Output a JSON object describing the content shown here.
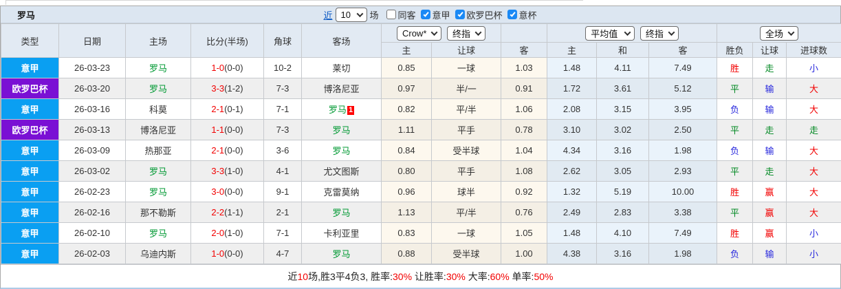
{
  "header": {
    "team_title": "罗马",
    "recent_prefix": "近",
    "recent_select_value": "10",
    "recent_suffix": "场",
    "filters": [
      {
        "label": "同客",
        "checked": false
      },
      {
        "label": "意甲",
        "checked": true
      },
      {
        "label": "欧罗巴杯",
        "checked": true
      },
      {
        "label": "意杯",
        "checked": true
      }
    ]
  },
  "table": {
    "top_headers": [
      "类型",
      "日期",
      "主场",
      "比分(半场)",
      "角球",
      "客场"
    ],
    "selects": {
      "bookmaker": "Crow*",
      "bookmaker_final": "终指",
      "average": "平均值",
      "average_final": "终指",
      "full_match": "全场"
    },
    "sub_headers": [
      "主",
      "让球",
      "客",
      "主",
      "和",
      "客",
      "胜负",
      "让球",
      "进球数"
    ],
    "rows": [
      {
        "type": "意甲",
        "type_style": "blue",
        "date": "26-03-23",
        "home": "罗马",
        "home_focus": true,
        "score_ft": "1-0",
        "score_ht": "(0-0)",
        "corners": "10-2",
        "away": "莱切",
        "away_focus": false,
        "away_badge": "",
        "crow_home": "0.85",
        "handicap": "一球",
        "crow_away": "1.03",
        "avg_home": "1.48",
        "avg_draw": "4.11",
        "avg_away": "7.49",
        "res_wdl": {
          "t": "胜",
          "c": "red"
        },
        "res_handicap": {
          "t": "走",
          "c": "green"
        },
        "res_goals": {
          "t": "小",
          "c": "blue"
        }
      },
      {
        "type": "欧罗巴杯",
        "type_style": "purple",
        "date": "26-03-20",
        "home": "罗马",
        "home_focus": true,
        "score_ft": "3-3",
        "score_ht": "(1-2)",
        "corners": "7-3",
        "away": "博洛尼亚",
        "away_focus": false,
        "away_badge": "",
        "crow_home": "0.97",
        "handicap": "半/一",
        "crow_away": "0.91",
        "avg_home": "1.72",
        "avg_draw": "3.61",
        "avg_away": "5.12",
        "res_wdl": {
          "t": "平",
          "c": "green"
        },
        "res_handicap": {
          "t": "输",
          "c": "blue"
        },
        "res_goals": {
          "t": "大",
          "c": "red"
        }
      },
      {
        "type": "意甲",
        "type_style": "blue",
        "date": "26-03-16",
        "home": "科莫",
        "home_focus": false,
        "score_ft": "2-1",
        "score_ht": "(0-1)",
        "corners": "7-1",
        "away": "罗马",
        "away_focus": true,
        "away_badge": "1",
        "crow_home": "0.82",
        "handicap": "平/半",
        "crow_away": "1.06",
        "avg_home": "2.08",
        "avg_draw": "3.15",
        "avg_away": "3.95",
        "res_wdl": {
          "t": "负",
          "c": "blue"
        },
        "res_handicap": {
          "t": "输",
          "c": "blue"
        },
        "res_goals": {
          "t": "大",
          "c": "red"
        }
      },
      {
        "type": "欧罗巴杯",
        "type_style": "purple",
        "date": "26-03-13",
        "home": "博洛尼亚",
        "home_focus": false,
        "score_ft": "1-1",
        "score_ht": "(0-0)",
        "corners": "7-3",
        "away": "罗马",
        "away_focus": true,
        "away_badge": "",
        "crow_home": "1.11",
        "handicap": "平手",
        "crow_away": "0.78",
        "avg_home": "3.10",
        "avg_draw": "3.02",
        "avg_away": "2.50",
        "res_wdl": {
          "t": "平",
          "c": "green"
        },
        "res_handicap": {
          "t": "走",
          "c": "green"
        },
        "res_goals": {
          "t": "走",
          "c": "green"
        }
      },
      {
        "type": "意甲",
        "type_style": "blue",
        "date": "26-03-09",
        "home": "热那亚",
        "home_focus": false,
        "score_ft": "2-1",
        "score_ht": "(0-0)",
        "corners": "3-6",
        "away": "罗马",
        "away_focus": true,
        "away_badge": "",
        "crow_home": "0.84",
        "handicap": "受半球",
        "crow_away": "1.04",
        "avg_home": "4.34",
        "avg_draw": "3.16",
        "avg_away": "1.98",
        "res_wdl": {
          "t": "负",
          "c": "blue"
        },
        "res_handicap": {
          "t": "输",
          "c": "blue"
        },
        "res_goals": {
          "t": "大",
          "c": "red"
        }
      },
      {
        "type": "意甲",
        "type_style": "blue",
        "date": "26-03-02",
        "home": "罗马",
        "home_focus": true,
        "score_ft": "3-3",
        "score_ht": "(1-0)",
        "corners": "4-1",
        "away": "尤文图斯",
        "away_focus": false,
        "away_badge": "",
        "crow_home": "0.80",
        "handicap": "平手",
        "crow_away": "1.08",
        "avg_home": "2.62",
        "avg_draw": "3.05",
        "avg_away": "2.93",
        "res_wdl": {
          "t": "平",
          "c": "green"
        },
        "res_handicap": {
          "t": "走",
          "c": "green"
        },
        "res_goals": {
          "t": "大",
          "c": "red"
        }
      },
      {
        "type": "意甲",
        "type_style": "blue",
        "date": "26-02-23",
        "home": "罗马",
        "home_focus": true,
        "score_ft": "3-0",
        "score_ht": "(0-0)",
        "corners": "9-1",
        "away": "克雷莫纳",
        "away_focus": false,
        "away_badge": "",
        "crow_home": "0.96",
        "handicap": "球半",
        "crow_away": "0.92",
        "avg_home": "1.32",
        "avg_draw": "5.19",
        "avg_away": "10.00",
        "res_wdl": {
          "t": "胜",
          "c": "red"
        },
        "res_handicap": {
          "t": "赢",
          "c": "red"
        },
        "res_goals": {
          "t": "大",
          "c": "red"
        }
      },
      {
        "type": "意甲",
        "type_style": "blue",
        "date": "26-02-16",
        "home": "那不勒斯",
        "home_focus": false,
        "score_ft": "2-2",
        "score_ht": "(1-1)",
        "corners": "2-1",
        "away": "罗马",
        "away_focus": true,
        "away_badge": "",
        "crow_home": "1.13",
        "handicap": "平/半",
        "crow_away": "0.76",
        "avg_home": "2.49",
        "avg_draw": "2.83",
        "avg_away": "3.38",
        "res_wdl": {
          "t": "平",
          "c": "green"
        },
        "res_handicap": {
          "t": "赢",
          "c": "red"
        },
        "res_goals": {
          "t": "大",
          "c": "red"
        }
      },
      {
        "type": "意甲",
        "type_style": "blue",
        "date": "26-02-10",
        "home": "罗马",
        "home_focus": true,
        "score_ft": "2-0",
        "score_ht": "(1-0)",
        "corners": "7-1",
        "away": "卡利亚里",
        "away_focus": false,
        "away_badge": "",
        "crow_home": "0.83",
        "handicap": "一球",
        "crow_away": "1.05",
        "avg_home": "1.48",
        "avg_draw": "4.10",
        "avg_away": "7.49",
        "res_wdl": {
          "t": "胜",
          "c": "red"
        },
        "res_handicap": {
          "t": "赢",
          "c": "red"
        },
        "res_goals": {
          "t": "小",
          "c": "blue"
        }
      },
      {
        "type": "意甲",
        "type_style": "blue",
        "date": "26-02-03",
        "home": "乌迪内斯",
        "home_focus": false,
        "score_ft": "1-0",
        "score_ht": "(0-0)",
        "corners": "4-7",
        "away": "罗马",
        "away_focus": true,
        "away_badge": "",
        "crow_home": "0.88",
        "handicap": "受半球",
        "crow_away": "1.00",
        "avg_home": "4.38",
        "avg_draw": "3.16",
        "avg_away": "1.98",
        "res_wdl": {
          "t": "负",
          "c": "blue"
        },
        "res_handicap": {
          "t": "输",
          "c": "blue"
        },
        "res_goals": {
          "t": "小",
          "c": "blue"
        }
      }
    ]
  },
  "footer": {
    "parts": [
      {
        "text": "近",
        "red": false
      },
      {
        "text": "10",
        "red": true
      },
      {
        "text": "场,胜3平4负3, 胜率:",
        "red": false
      },
      {
        "text": "30%",
        "red": true
      },
      {
        "text": " 让胜率:",
        "red": false
      },
      {
        "text": "30%",
        "red": true
      },
      {
        "text": " 大率:",
        "red": false
      },
      {
        "text": "60%",
        "red": true
      },
      {
        "text": " 单率:",
        "red": false
      },
      {
        "text": "50%",
        "red": true
      }
    ]
  },
  "colors": {
    "league_serie_a_bg": "#0a9ff2",
    "league_europa_bg": "#7a10d4",
    "focus_team_green": "#009933",
    "score_red": "#f20000",
    "result_red": "#f20000",
    "result_green": "#008822",
    "result_blue": "#2929dd",
    "header_bg": "#e2eaf3",
    "topbar_bg": "#dce6f1",
    "checked_checkbox_blue": "#1a89f5",
    "alt_row_bg": "#efefef",
    "handicap_col_bg": "#fdf8ee",
    "avg_col_bg": "#eaf3fb"
  }
}
